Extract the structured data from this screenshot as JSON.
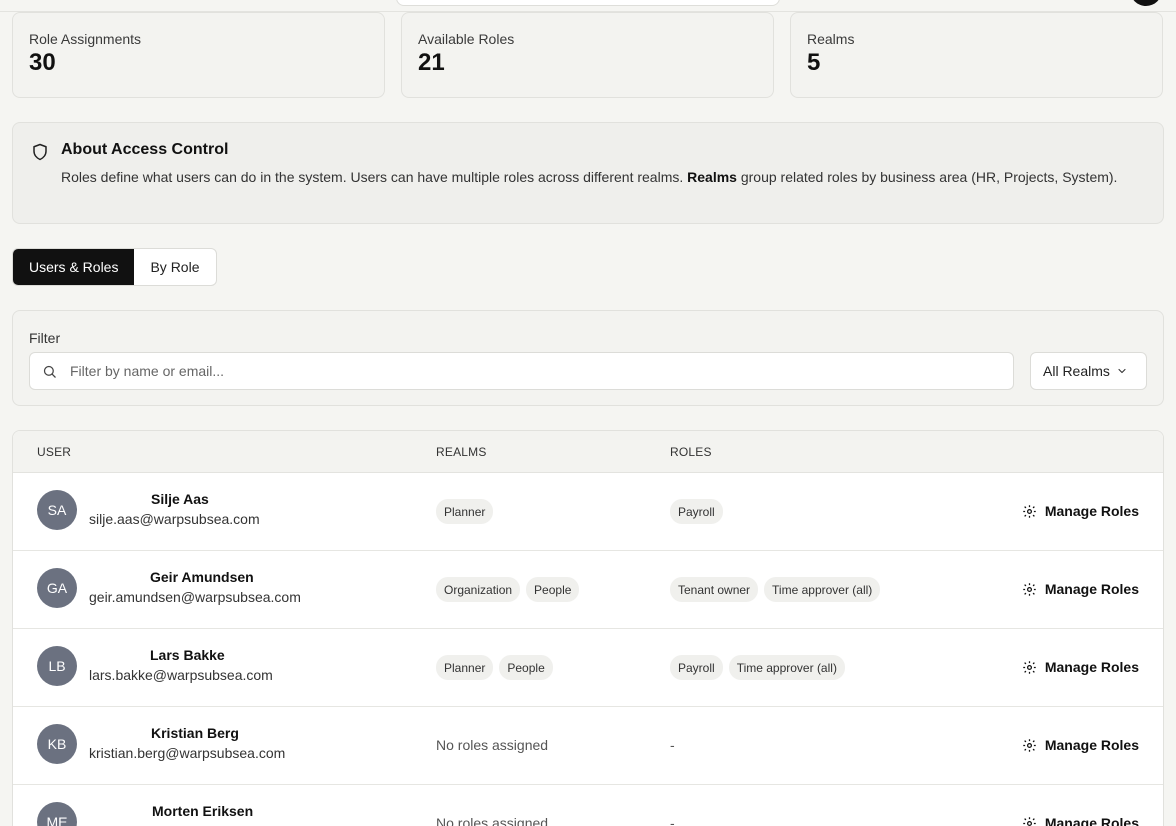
{
  "stats": [
    {
      "label": "Role Assignments",
      "value": "30"
    },
    {
      "label": "Available Roles",
      "value": "21"
    },
    {
      "label": "Realms",
      "value": "5"
    }
  ],
  "about": {
    "title": "About Access Control",
    "desc_prefix": "Roles define what users can do in the system. Users can have multiple roles across different realms. ",
    "desc_bold": "Realms",
    "desc_suffix": " group related roles by business area (HR, Projects, System).",
    "icon": "shield-icon"
  },
  "tabs": [
    {
      "label": "Users & Roles",
      "active": true
    },
    {
      "label": "By Role",
      "active": false
    }
  ],
  "filter": {
    "label": "Filter",
    "placeholder": "Filter by name or email...",
    "realm_select": "All Realms"
  },
  "table": {
    "headers": {
      "user": "USER",
      "realms": "REALMS",
      "roles": "ROLES"
    },
    "manage_label": "Manage Roles",
    "no_roles": "No roles assigned",
    "dash": "-",
    "rows": [
      {
        "initials": "SA",
        "name": "Silje Aas",
        "email": "silje.aas@warpsubsea.com",
        "realms": [
          "Planner"
        ],
        "roles": [
          "Payroll"
        ]
      },
      {
        "initials": "GA",
        "name": "Geir Amundsen",
        "email": "geir.amundsen@warpsubsea.com",
        "realms": [
          "Organization",
          "People"
        ],
        "roles": [
          "Tenant owner",
          "Time approver (all)"
        ]
      },
      {
        "initials": "LB",
        "name": "Lars Bakke",
        "email": "lars.bakke@warpsubsea.com",
        "realms": [
          "Planner",
          "People"
        ],
        "roles": [
          "Payroll",
          "Time approver (all)"
        ]
      },
      {
        "initials": "KB",
        "name": "Kristian Berg",
        "email": "kristian.berg@warpsubsea.com",
        "realms": [],
        "roles": []
      },
      {
        "initials": "ME",
        "name": "Morten Eriksen",
        "email": "",
        "realms": [],
        "roles": []
      }
    ]
  },
  "colors": {
    "accent": "#111111",
    "avatar": "#6b7180",
    "chip": "#f0f0ed"
  }
}
